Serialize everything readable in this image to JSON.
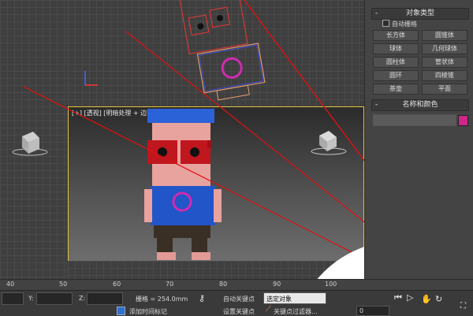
{
  "viewport": {
    "perspective_label": "[+] [透视] [明暗处理 + 边面]"
  },
  "command_panel": {
    "object_type": {
      "title": "对象类型",
      "toggle": "-",
      "autogrid_label": "自动栅格",
      "buttons": [
        [
          "长方体",
          "圆锥体"
        ],
        [
          "球体",
          "几何球体"
        ],
        [
          "圆柱体",
          "管状体"
        ],
        [
          "圆环",
          "四棱锥"
        ],
        [
          "茶壶",
          "平面"
        ]
      ]
    },
    "name_color": {
      "title": "名称和颜色",
      "toggle": "-",
      "name_value": "",
      "swatch_color": "#d0268a"
    }
  },
  "timeline": {
    "ticks": [
      "40",
      "50",
      "60",
      "70",
      "80",
      "90",
      "100"
    ]
  },
  "status_bar": {
    "y_label": "Y:",
    "z_label": "Z:",
    "grid_label": "栅格 = 254.0mm",
    "add_time_tag": "添加时间标记",
    "auto_key": "自动关键点",
    "selected_object": "选定对象",
    "set_key": "设置关键点",
    "key_filters": "关键点过滤器...",
    "frame_value": "0"
  },
  "colors": {
    "accent_swatch": "#d0268a",
    "shirt_blue": "#2255c8",
    "glasses_red": "#c0161e",
    "skin": "#e9a09b",
    "guide_red": "#e01010"
  }
}
